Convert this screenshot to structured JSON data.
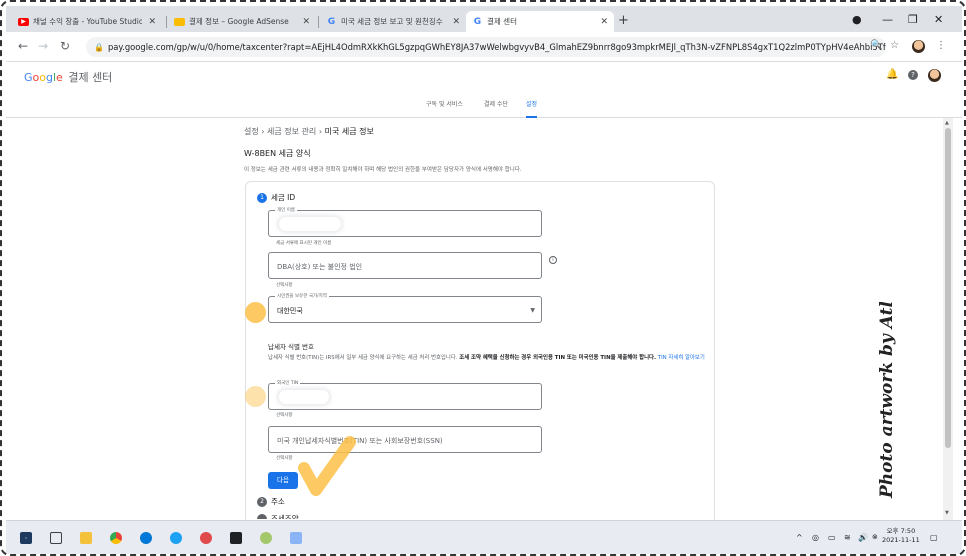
{
  "browser": {
    "tabs": [
      {
        "title": "채널 수익 창출 - YouTube Studio",
        "favicon": "youtube-icon",
        "color": "#ff0000"
      },
      {
        "title": "결제 정보 – Google AdSense",
        "favicon": "adsense-icon",
        "color": "#fbbc04"
      },
      {
        "title": "미국 세금 정보 보고 및 원천징수",
        "favicon": "google-icon",
        "color": "#4285f4"
      },
      {
        "title": "결제 센터",
        "favicon": "google-icon",
        "color": "#4285f4"
      }
    ],
    "new_tab": "+",
    "url": "pay.google.com/gp/w/u/0/home/taxcenter?rapt=AEjHL4OdmRXkKhGL5gzpqGWhEY8JA37wWelwbgvyvB4_GlmahEZ9bnrr8go93mpkrMEJl_qTh3N-vZFNPL8S4gxT1Q2zlmP0TYpHV4eAhbi5Tfe-NB2h1..."
  },
  "app": {
    "logo": "Google",
    "product": "결제 센터"
  },
  "nav": {
    "tabs": [
      "구독 및 서비스",
      "결제 수단",
      "설정"
    ],
    "active": "설정"
  },
  "breadcrumb": {
    "items": [
      "설정",
      "세금 정보 관리",
      "미국 세금 정보"
    ],
    "separator": "›"
  },
  "form": {
    "title": "W-8BEN 세금 양식",
    "description": "이 정보는 세금 관련 서류의 내용과 정확히 일치해야 하며 해당 법인의 권한을 부여받은 담당자가 양식에 서명해야 합니다.",
    "step1": {
      "num": "1",
      "label": "세금 ID"
    },
    "individual_name": {
      "label": "개인 이름",
      "hint": "세금 서류에 표시된 개인 이름"
    },
    "dba": {
      "placeholder": "DBA(상호) 또는 불인정 법인",
      "hint": "선택사항"
    },
    "country": {
      "label": "시민권을 보유한 국가/지역",
      "value": "대한민국"
    },
    "tin_section": {
      "title": "납세자 식별 번호",
      "para_pre": "납세자 식별 번호(TIN)는 IRS에서 일부 세금 양식에 요구하는 세금 처리 번호입니다. ",
      "para_bold": "조세 조약 혜택을 신청하는 경우 외국인용 TIN 또는 미국인용 TIN을 제출해야 합니다.",
      "link": "TIN 자세히 알아보기"
    },
    "foreign_tin": {
      "label": "외국인 TIN",
      "hint": "선택사항"
    },
    "us_tin": {
      "placeholder": "미국 개인납세자식별번호(TIN) 또는 사회보장번호(SSN)",
      "hint": "선택사항"
    },
    "next_button": "다음",
    "step2": {
      "num": "2",
      "label": "주소"
    },
    "step3": {
      "num": "3",
      "label": "조세조약"
    }
  },
  "watermark": "Photo artwork by Atlas",
  "taskbar": {
    "time": "오후 7:50",
    "date": "2021-11-11"
  },
  "colors": {
    "accent": "#1a73e8",
    "highlight": "#fbbf46"
  }
}
